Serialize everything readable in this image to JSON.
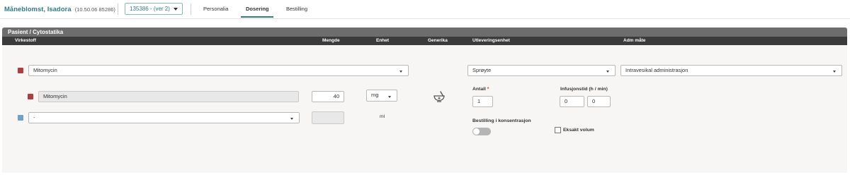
{
  "header": {
    "patient_name": "Måneblomst, Isadora",
    "patient_id": "(10.50.06 85286)",
    "version": "135386 - (ver 2)",
    "tabs": [
      {
        "label": "Personalia"
      },
      {
        "label": "Dosering"
      },
      {
        "label": "Bestilling"
      }
    ],
    "active_tab": "Dosering"
  },
  "panel": {
    "title": "Pasient / Cytostatika",
    "columns": {
      "virkestoff": "Virkestoff",
      "mengde": "Mengde",
      "enhet": "Enhet",
      "generika": "Generika",
      "utleveringsenhet": "Utleveringsenhet",
      "adm_mate": "Adm måte"
    },
    "row1": {
      "virkestoff": "Mitomycin",
      "utleveringsenhet": "Sprøyte",
      "adm_mate": "Intravesikal administrasjon"
    },
    "row2": {
      "virkestoff": "Mitomycin",
      "mengde": "40",
      "enhet": "mg",
      "antall_label": "Antall",
      "antall_required": "*",
      "antall": "1",
      "infusjon_label": "Infusjonstid (h / min)",
      "infusjon_h": "0",
      "infusjon_min": "0"
    },
    "row3": {
      "virkestoff": "-",
      "mengde": "",
      "enhet": "ml",
      "bestilling_label": "Bestilling i konsentrasjon",
      "eksakt_label": "Eksakt volum"
    },
    "colors": {
      "red": "#b33b3b",
      "blue": "#6aa1d1",
      "accent": "#2f7f86"
    }
  }
}
